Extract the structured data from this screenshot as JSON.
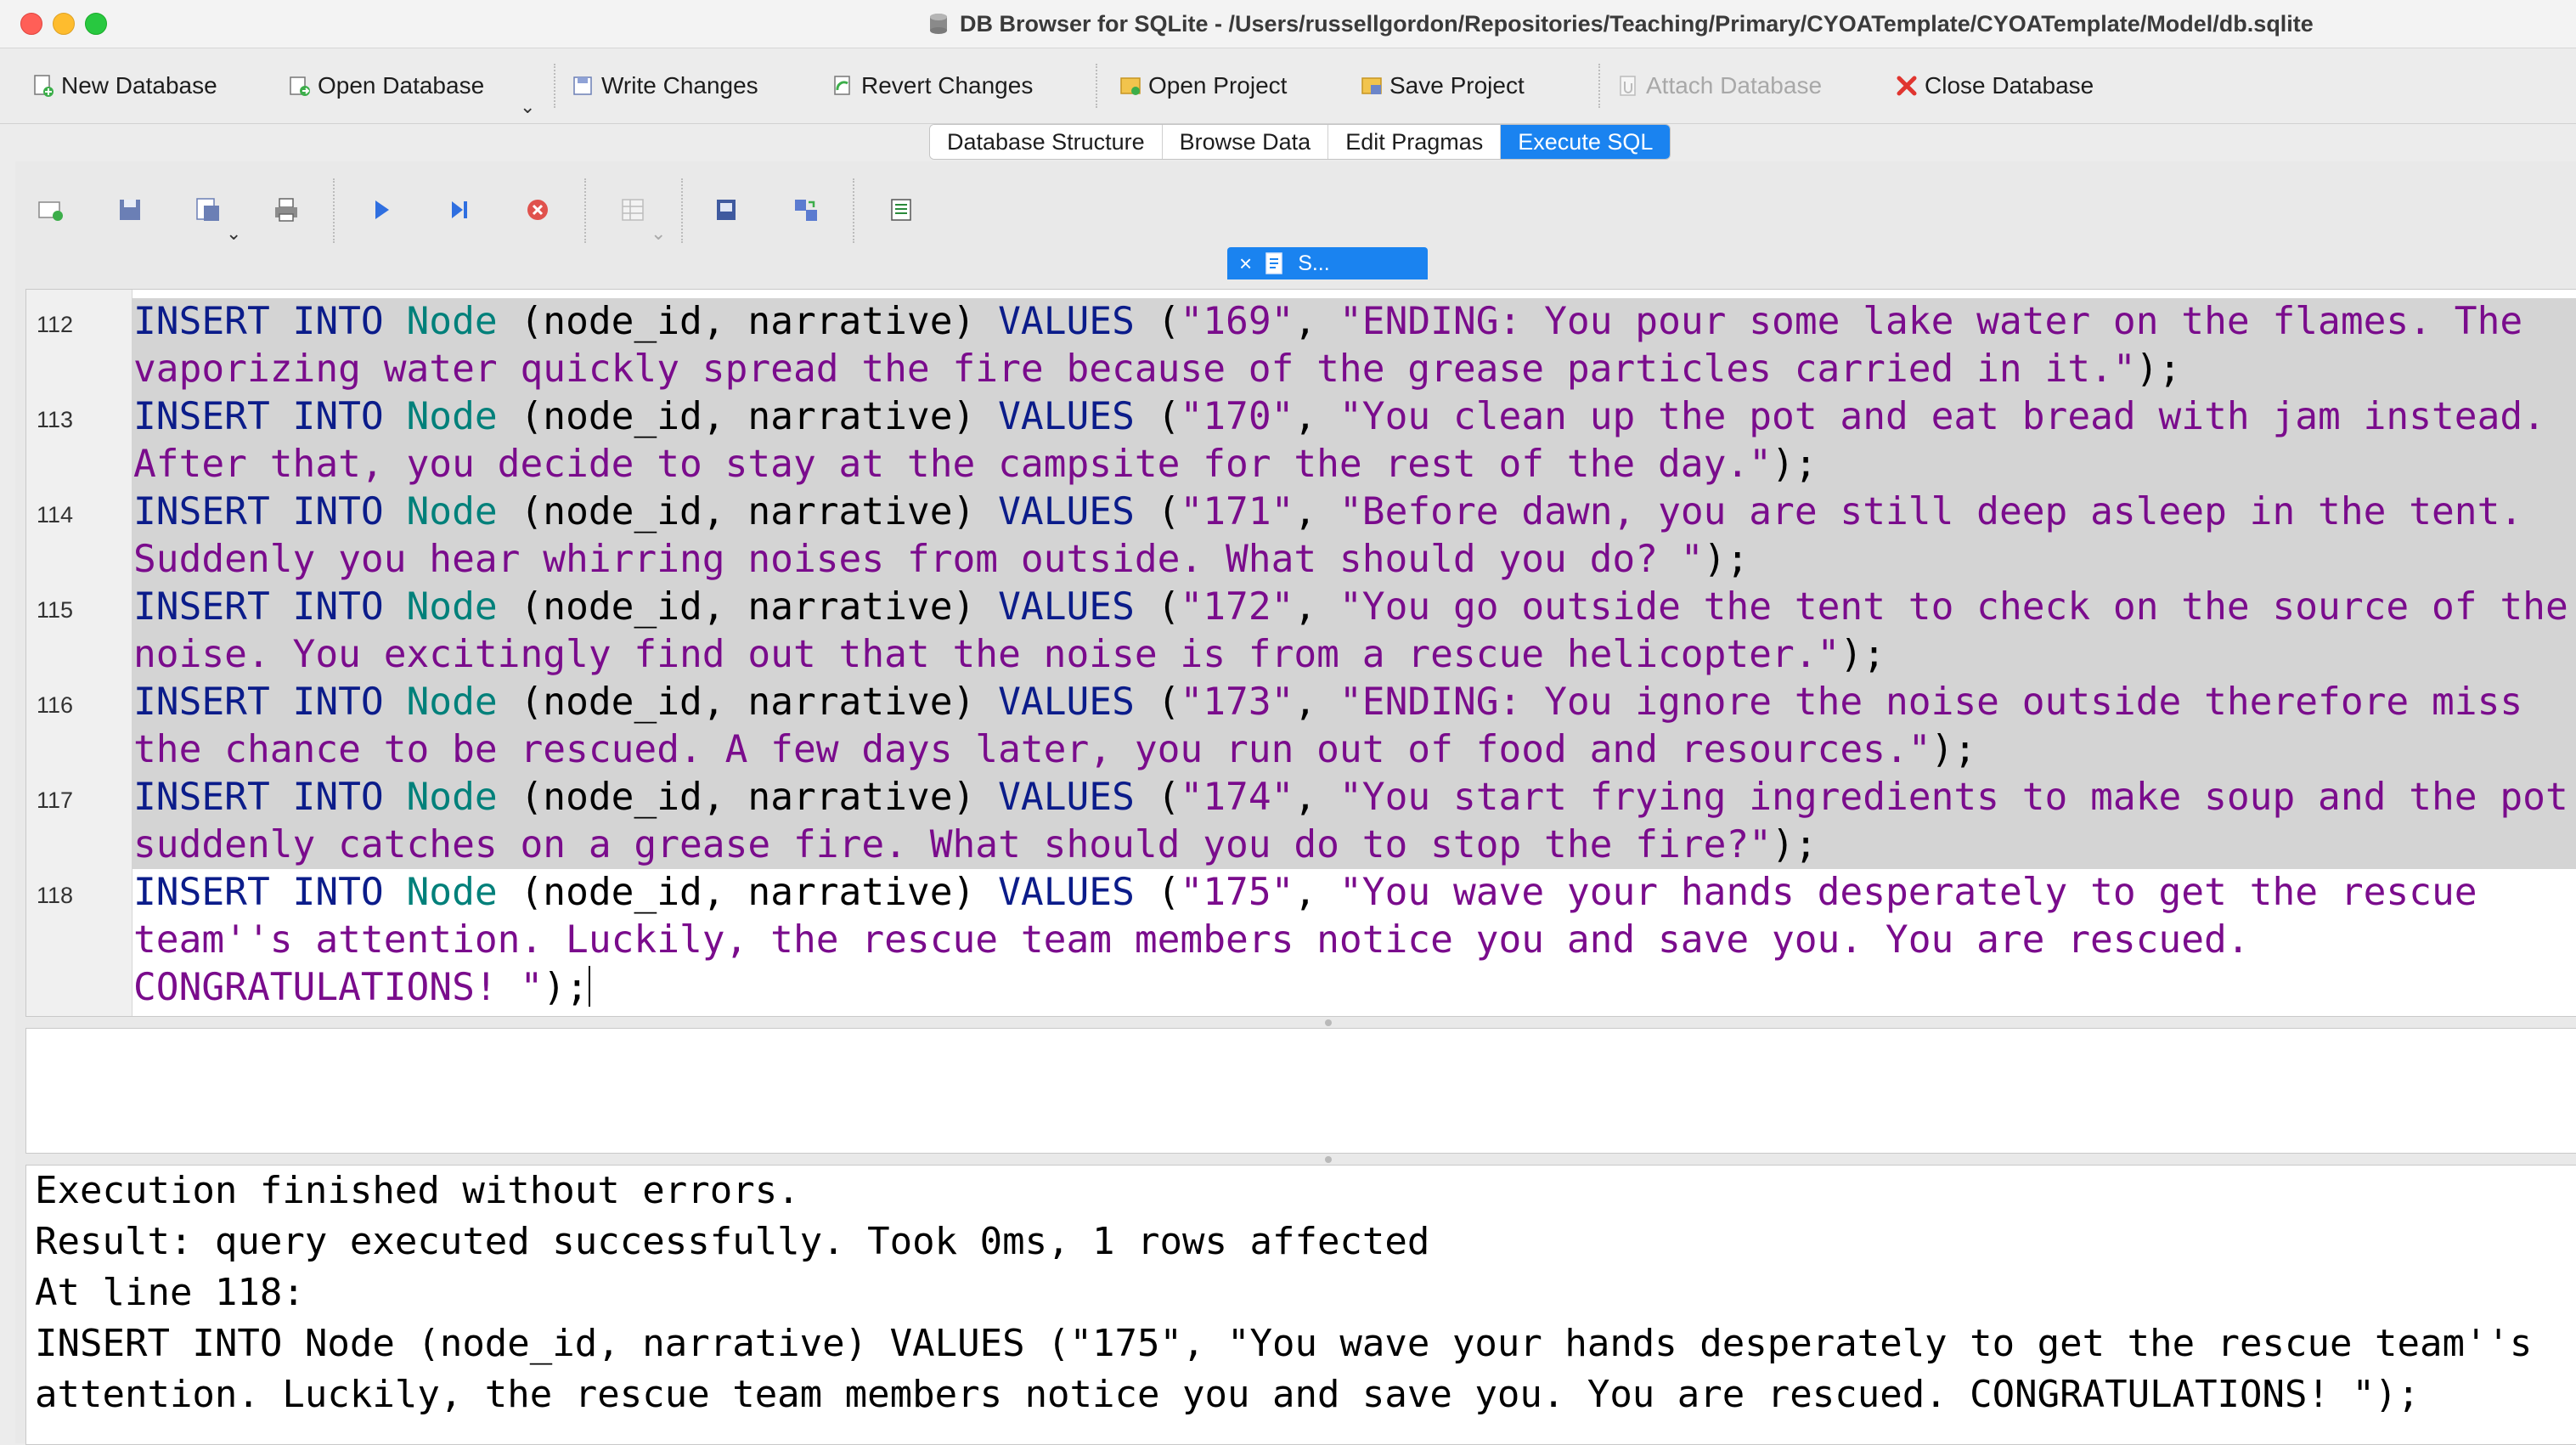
{
  "window": {
    "title": "DB Browser for SQLite - /Users/russellgordon/Repositories/Teaching/Primary/CYOATemplate/CYOATemplate/Model/db.sqlite"
  },
  "toolbar": {
    "new_database": "New Database",
    "open_database": "Open Database",
    "write_changes": "Write Changes",
    "revert_changes": "Revert Changes",
    "open_project": "Open Project",
    "save_project": "Save Project",
    "attach_database": "Attach Database",
    "close_database": "Close Database"
  },
  "tabs": [
    {
      "label": "Database Structure",
      "active": false
    },
    {
      "label": "Browse Data",
      "active": false
    },
    {
      "label": "Edit Pragmas",
      "active": false
    },
    {
      "label": "Execute SQL",
      "active": true
    }
  ],
  "editor_tab": {
    "close": "×",
    "label": "S..."
  },
  "editor": {
    "lines": [
      {
        "number": "112",
        "row1": {
          "kw1": "INSERT INTO",
          "table": "Node",
          "cols": "(node_id, narrative)",
          "kw2": "VALUES",
          "open": "(",
          "id": "\"169\"",
          "comma": ", ",
          "text": "\"ENDING: You pour some lake water on the flames. The"
        },
        "row2": {
          "text": "vaporizing water quickly spread the fire because of the grease particles carried in it.\"",
          "end": ");"
        }
      },
      {
        "number": "113",
        "row1": {
          "kw1": "INSERT INTO",
          "table": "Node",
          "cols": "(node_id, narrative)",
          "kw2": "VALUES",
          "open": "(",
          "id": "\"170\"",
          "comma": ", ",
          "text": "\"You clean up the pot and eat bread with jam instead."
        },
        "row2": {
          "text": "After that, you decide to stay at the campsite for the rest of the day.\"",
          "end": ");"
        }
      },
      {
        "number": "114",
        "row1": {
          "kw1": "INSERT INTO",
          "table": "Node",
          "cols": "(node_id, narrative)",
          "kw2": "VALUES",
          "open": "(",
          "id": "\"171\"",
          "comma": ", ",
          "text": "\"Before dawn, you are still deep asleep in the tent."
        },
        "row2": {
          "text": "Suddenly you hear whirring noises from outside. What should you do? \"",
          "end": ");"
        }
      },
      {
        "number": "115",
        "row1": {
          "kw1": "INSERT INTO",
          "table": "Node",
          "cols": "(node_id, narrative)",
          "kw2": "VALUES",
          "open": "(",
          "id": "\"172\"",
          "comma": ", ",
          "text": "\"You go outside the tent to check on the source of the"
        },
        "row2": {
          "text": "noise. You excitingly find out that the noise is from a rescue helicopter.\"",
          "end": ");"
        }
      },
      {
        "number": "116",
        "row1": {
          "kw1": "INSERT INTO",
          "table": "Node",
          "cols": "(node_id, narrative)",
          "kw2": "VALUES",
          "open": "(",
          "id": "\"173\"",
          "comma": ", ",
          "text": "\"ENDING: You ignore the noise outside therefore miss"
        },
        "row2": {
          "text": "the chance to be rescued. A few days later, you run out of food and resources.\"",
          "end": ");"
        }
      },
      {
        "number": "117",
        "row1": {
          "kw1": "INSERT INTO",
          "table": "Node",
          "cols": "(node_id, narrative)",
          "kw2": "VALUES",
          "open": "(",
          "id": "\"174\"",
          "comma": ", ",
          "text": "\"You start frying ingredients to make soup and the pot"
        },
        "row2": {
          "text": "suddenly catches on a grease fire. What should you do to stop the fire?\"",
          "end": ");"
        }
      },
      {
        "number": "118",
        "row1": {
          "kw1": "INSERT INTO",
          "table": "Node",
          "cols": "(node_id, narrative)",
          "kw2": "VALUES",
          "open": "(",
          "id": "\"175\"",
          "comma": ", ",
          "text": "\"You wave your hands desperately to get the rescue"
        },
        "row2": {
          "text": "team''s attention. Luckily, the rescue team members notice you and save you. You are rescued."
        },
        "row3": {
          "text": "CONGRATULATIONS! \"",
          "end": ");"
        }
      }
    ]
  },
  "messages": {
    "line1": "Execution finished without errors.",
    "line2": "Result: query executed successfully. Took 0ms, 1 rows affected",
    "line3": "At line 118:",
    "line4": "INSERT INTO Node (node_id, narrative) VALUES (\"175\", \"You wave your hands desperately to get the rescue team''s",
    "line5": "attention. Luckily, the rescue team members notice you and save you. You are rescued. CONGRATULATIONS! \");"
  }
}
